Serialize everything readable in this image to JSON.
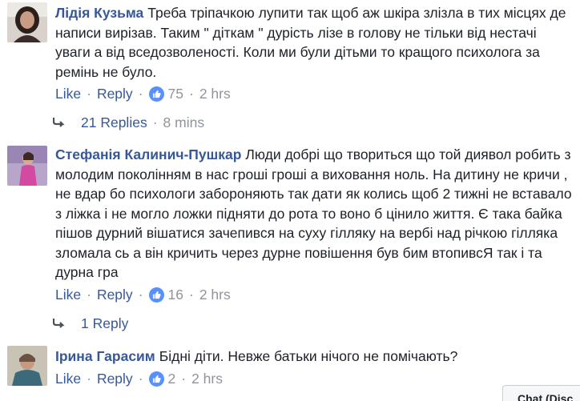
{
  "comments": [
    {
      "author": "Лідія Кузьма",
      "text": "Треба тріпачкою лупити так щоб аж шкіра злізла в тих місцях де написи вирізав. Таким \" діткам \" дурість лізе в голову не тільки від нестачі уваги а від вседозволеності. Коли ми були дітьми то кращого психолога за ремінь не було.",
      "like_label": "Like",
      "reply_label": "Reply",
      "likes": "75",
      "time": "2 hrs",
      "replies_label": "21 Replies",
      "replies_time": "8 mins"
    },
    {
      "author": "Стефанія Калинич-Пушкар",
      "text": "Люди добрі що твориться що той диявол робить з молодим поколінням в нас гроші гроші а виховання ноль. На дитину не кричи , не вдар бо психологи забороняють так дати як колись щоб 2 тижні не вставало з ліжка і не могло ложки підняти до рота то воно б цінило життя. Є така байка пішов дурний вішатися зачепився на суху гілляку на вербі над річкою гілляка зломала сь а він кричить через дурне повішення був бим втопивсЯ так і та дурна гра",
      "like_label": "Like",
      "reply_label": "Reply",
      "likes": "16",
      "time": "2 hrs",
      "replies_label": "1 Reply"
    },
    {
      "author": "Ірина Гарасим",
      "text": "Бідні діти. Невже батьки нічого не помічають?",
      "like_label": "Like",
      "reply_label": "Reply",
      "likes": "2",
      "time": "2 hrs"
    }
  ],
  "chat_tab": {
    "label": "Chat (Disc"
  },
  "colors": {
    "link": "#365899",
    "muted": "#90949c",
    "text": "#1d2129",
    "like_badge": "#5890ff"
  },
  "icons": {
    "like": "thumbs-up-icon",
    "reply_arrow": "reply-arrow-icon"
  }
}
